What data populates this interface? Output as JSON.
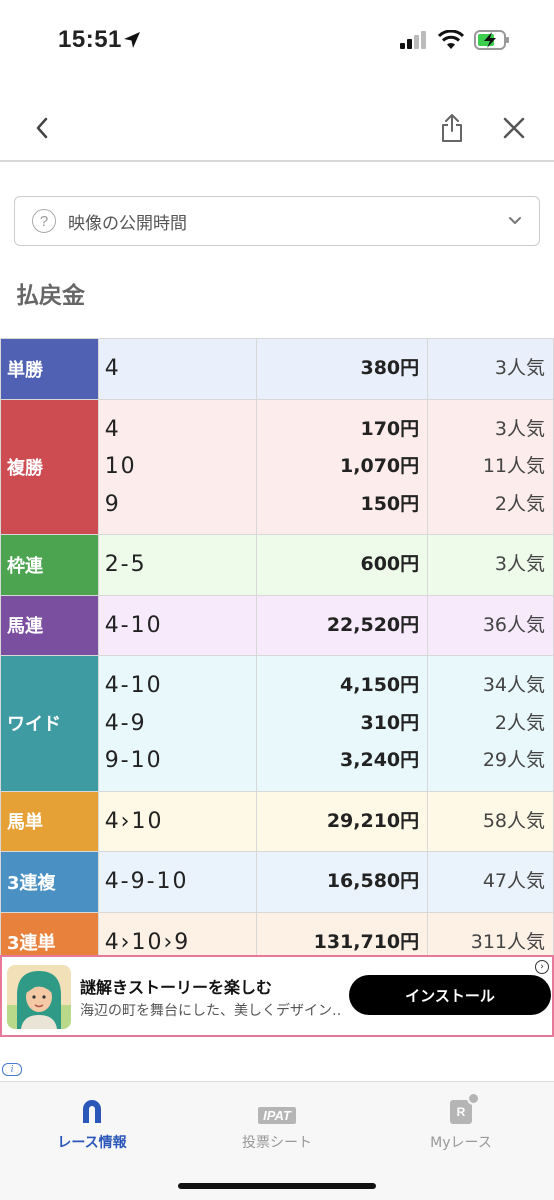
{
  "status_bar": {
    "time": "15:51"
  },
  "video_select": {
    "label": "映像の公開時間"
  },
  "section_title": "払戻金",
  "payouts": [
    {
      "type": "単勝",
      "color": "#5060b3",
      "bg": "#eaf0fb",
      "rows": [
        {
          "combo": "4",
          "payout": "380円",
          "popularity": "3人気"
        }
      ]
    },
    {
      "type": "複勝",
      "color": "#cc4c52",
      "bg": "#fdecec",
      "rows": [
        {
          "combo": "4",
          "payout": "170円",
          "popularity": "3人気"
        },
        {
          "combo": "10",
          "payout": "1,070円",
          "popularity": "11人気"
        },
        {
          "combo": "9",
          "payout": "150円",
          "popularity": "2人気"
        }
      ]
    },
    {
      "type": "枠連",
      "color": "#4ca451",
      "bg": "#eefaea",
      "rows": [
        {
          "combo": "2-5",
          "payout": "600円",
          "popularity": "3人気"
        }
      ]
    },
    {
      "type": "馬連",
      "color": "#7b4fa0",
      "bg": "#f6eafb",
      "rows": [
        {
          "combo": "4-10",
          "payout": "22,520円",
          "popularity": "36人気"
        }
      ]
    },
    {
      "type": "ワイド",
      "color": "#3f9ba2",
      "bg": "#e9f8fa",
      "rows": [
        {
          "combo": "4-10",
          "payout": "4,150円",
          "popularity": "34人気"
        },
        {
          "combo": "4-9",
          "payout": "310円",
          "popularity": "2人気"
        },
        {
          "combo": "9-10",
          "payout": "3,240円",
          "popularity": "29人気"
        }
      ]
    },
    {
      "type": "馬単",
      "color": "#e5a136",
      "bg": "#fdf9e6",
      "rows": [
        {
          "combo": "4›10",
          "payout": "29,210円",
          "popularity": "58人気"
        }
      ]
    },
    {
      "type": "3連複",
      "color": "#4a90c2",
      "bg": "#eaf3fb",
      "rows": [
        {
          "combo": "4-9-10",
          "payout": "16,580円",
          "popularity": "47人気"
        }
      ]
    },
    {
      "type": "3連単",
      "color": "#e7813c",
      "bg": "#fdf1e6",
      "rows": [
        {
          "combo": "4›10›9",
          "payout": "131,710円",
          "popularity": "311人気"
        }
      ]
    }
  ],
  "ad": {
    "title": "謎解きストーリーを楽しむ",
    "description": "海辺の町を舞台にした、美しくデザイン…",
    "button": "インストール"
  },
  "tabbar": {
    "tabs": [
      {
        "label": "レース情報",
        "active": true
      },
      {
        "label": "投票シート",
        "active": false,
        "badge": "IPAT"
      },
      {
        "label": "Myレース",
        "active": false,
        "badge": "R"
      }
    ]
  },
  "colors": {
    "accent": "#2b57b8",
    "ad_border": "#e8789a"
  }
}
